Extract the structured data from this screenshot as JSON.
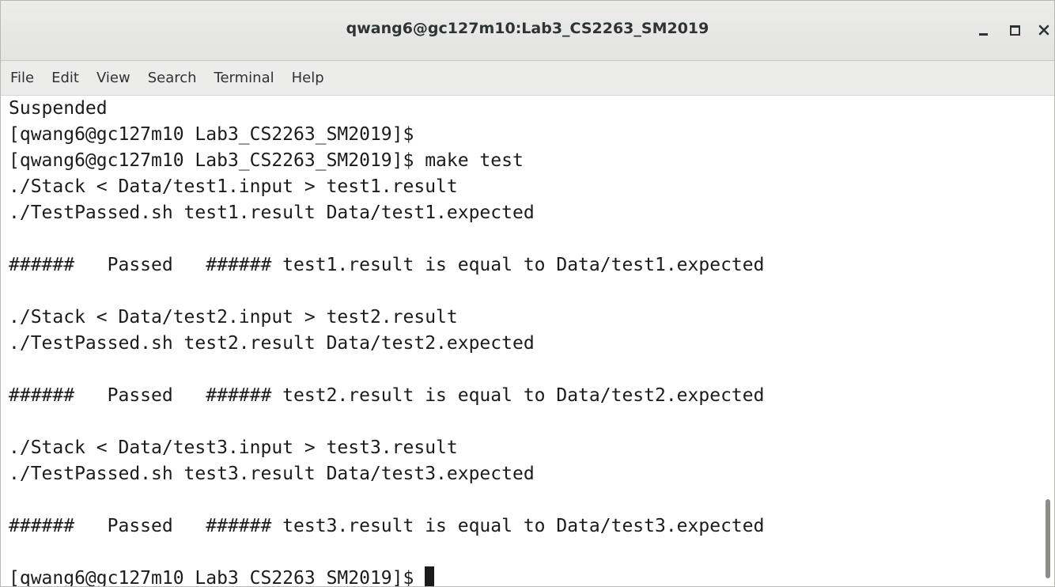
{
  "window": {
    "title": "qwang6@gc127m10:Lab3_CS2263_SM2019"
  },
  "menu": {
    "items": [
      "File",
      "Edit",
      "View",
      "Search",
      "Terminal",
      "Help"
    ]
  },
  "terminal": {
    "lines": [
      "Suspended",
      "[qwang6@gc127m10 Lab3_CS2263_SM2019]$",
      "[qwang6@gc127m10 Lab3_CS2263_SM2019]$ make test",
      "./Stack < Data/test1.input > test1.result",
      "./TestPassed.sh test1.result Data/test1.expected",
      "",
      "######   Passed   ###### test1.result is equal to Data/test1.expected",
      "",
      "./Stack < Data/test2.input > test2.result",
      "./TestPassed.sh test2.result Data/test2.expected",
      "",
      "######   Passed   ###### test2.result is equal to Data/test2.expected",
      "",
      "./Stack < Data/test3.input > test3.result",
      "./TestPassed.sh test3.result Data/test3.expected",
      "",
      "######   Passed   ###### test3.result is equal to Data/test3.expected",
      ""
    ],
    "prompt": "[qwang6@gc127m10 Lab3_CS2263_SM2019]$ "
  }
}
